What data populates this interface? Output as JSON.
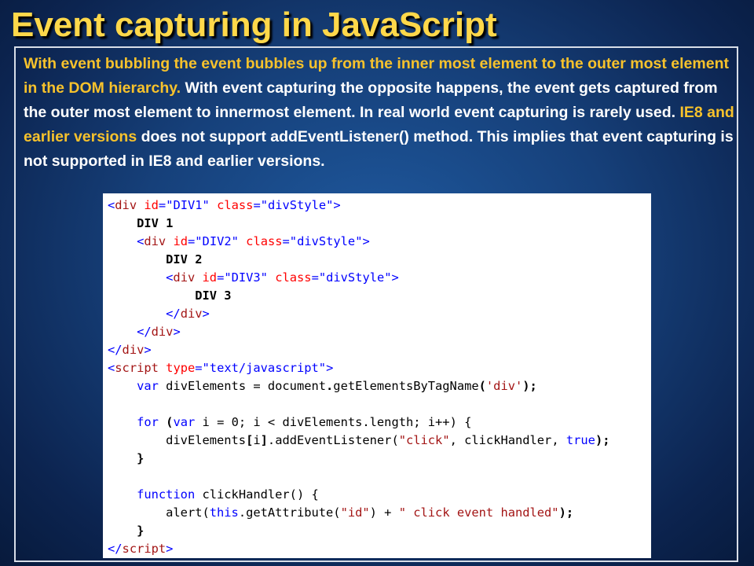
{
  "title": "Event capturing in JavaScript",
  "paragraph": {
    "seg1": "With event bubbling the event bubbles up from the inner most element to the outer most element in the DOM hierarchy.",
    "seg2": " With event capturing the opposite happens, the event gets captured from the outer most element to innermost element. In real world event capturing is rarely used. ",
    "seg3": "IE8 and earlier versions",
    "seg4": " does not support addEventListener() method. This implies that event capturing is not supported in IE8 and earlier versions."
  },
  "code": {
    "l1": {
      "p1": "<",
      "p2": "div",
      "p3": " ",
      "p4": "id",
      "p5": "=",
      "p6": "\"DIV1\"",
      "p7": " ",
      "p8": "class",
      "p9": "=",
      "p10": "\"divStyle\"",
      "p11": ">"
    },
    "l2": {
      "indent": "    ",
      "text": "DIV 1"
    },
    "l3": {
      "indent": "    ",
      "p1": "<",
      "p2": "div",
      "p3": " ",
      "p4": "id",
      "p5": "=",
      "p6": "\"DIV2\"",
      "p7": " ",
      "p8": "class",
      "p9": "=",
      "p10": "\"divStyle\"",
      "p11": ">"
    },
    "l4": {
      "indent": "        ",
      "text": "DIV 2"
    },
    "l5": {
      "indent": "        ",
      "p1": "<",
      "p2": "div",
      "p3": " ",
      "p4": "id",
      "p5": "=",
      "p6": "\"DIV3\"",
      "p7": " ",
      "p8": "class",
      "p9": "=",
      "p10": "\"divStyle\"",
      "p11": ">"
    },
    "l6": {
      "indent": "            ",
      "text": "DIV 3"
    },
    "l7": {
      "indent": "        ",
      "p1": "</",
      "p2": "div",
      "p3": ">"
    },
    "l8": {
      "indent": "    ",
      "p1": "</",
      "p2": "div",
      "p3": ">"
    },
    "l9": {
      "p1": "</",
      "p2": "div",
      "p3": ">"
    },
    "l10": {
      "p1": "<",
      "p2": "script",
      "p3": " ",
      "p4": "type",
      "p5": "=",
      "p6": "\"text/javascript\"",
      "p7": ">"
    },
    "l11": {
      "indent": "    ",
      "kw": "var",
      "rest1": " divElements = document",
      "dot": ".",
      "rest2": "getElementsByTagName",
      "paren": "(",
      "str": "'div'",
      "end": ");"
    },
    "l12": "",
    "l13": {
      "indent": "    ",
      "kw": "for",
      "sp": " ",
      "p1": "(",
      "kw2": "var",
      "rest": " i = 0; i < divElements.length; i++) {"
    },
    "l14": {
      "indent": "        ",
      "a": "divElements",
      "b": "[",
      "c": "i",
      "d": "]",
      "e": ".addEventListener(",
      "str": "\"click\"",
      "f": ", clickHandler, ",
      "kw": "true",
      "g": ");"
    },
    "l15": {
      "indent": "    ",
      "text": "}"
    },
    "l16": "",
    "l17": {
      "indent": "    ",
      "kw": "function",
      "rest": " clickHandler() {"
    },
    "l18": {
      "indent": "        ",
      "a": "alert(",
      "kw": "this",
      "b": ".getAttribute(",
      "str1": "\"id\"",
      "c": ") + ",
      "str2": "\" click event handled\"",
      "d": ");"
    },
    "l19": {
      "indent": "    ",
      "text": "}"
    },
    "l20": {
      "p1": "</",
      "p2": "script",
      "p3": ">"
    }
  }
}
